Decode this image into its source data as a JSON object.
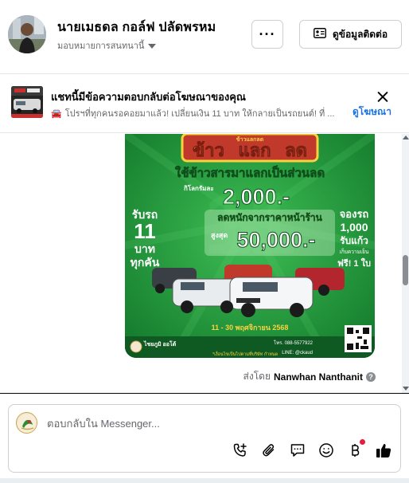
{
  "header": {
    "name": "นายเมธดล กอล์ฟ ปลัดพรหม",
    "role": "มอบหมายการสนทนานี้",
    "more_label": "···",
    "contact_label": "ดูข้อมูลติดต่อ"
  },
  "banner": {
    "title": "แชทนี้มีข้อความตอบกลับต่อโฆษณาของคุณ",
    "subtitle": "โปรฯที่ทุกคนรอคอยมาแล้ว! เปลี่ยนเงิน 11 บาท ให้กลายเป็นรถยนต์! ที่ ...",
    "see_ad": "ดูโฆษณา"
  },
  "ad": {
    "top_small": "ข้าวแลกลด",
    "headline_rice": "ข้าว",
    "headline_swap": "แลก",
    "headline_cut": "ลด",
    "sub_headline": "ใช้ข้าวสารมาแลกเป็นส่วนลด",
    "per_kg": "กิโลกรัมละ",
    "per_kg_amount": "2,000.-",
    "down_payment": "ลดหนักจากราคาหน้าร้าน",
    "max_label": "สูงสุด",
    "max_amount": "50,000.-",
    "left_1": "รับรถ",
    "left_2": "11",
    "left_3": "บาท",
    "left_4": "ทุกคัน",
    "right_1": "จองรถ",
    "right_2": "1,000",
    "right_3": "รับแก้ว",
    "right_4": "เก็บความเย็น",
    "right_5": "ฟรี! 1 ใบ",
    "date_range": "11 - 30 พฤศจิกายน 2568",
    "phone": "โทร. 088-5577922",
    "line": "LINE: @ckaud",
    "footnote": "*เงื่อนไขเป็นไปตามที่บริษัท กำหนด",
    "brand": "ไชยภูมิ ออโต้",
    "colors": {
      "green": "#1e8c3a",
      "gold": "#f7d23e",
      "red": "#e43c2a"
    }
  },
  "message": {
    "sent_by_prefix": "ส่งโดย",
    "sent_by_name": "Nanwhan Nanthanit"
  },
  "composer": {
    "placeholder": "ตอบกลับใน Messenger...",
    "tools": [
      "call-icon",
      "attachment-icon",
      "saved-reply-icon",
      "emoji-icon",
      "baht-icon",
      "like-icon"
    ]
  }
}
